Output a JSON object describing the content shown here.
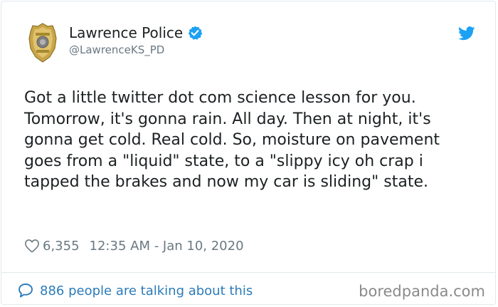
{
  "header": {
    "display_name": "Lawrence Police",
    "handle": "@LawrenceKS_PD",
    "avatar_icon": "police-badge-icon",
    "verified_icon": "verified-badge-icon",
    "platform_icon": "twitter-bird-icon"
  },
  "tweet": {
    "text": "Got a little twitter dot com science lesson for you. Tomorrow, it's gonna rain. All day. Then at night, it's gonna get cold. Real cold. So, moisture on pavement goes from a \"liquid\" state, to a \"slippy icy oh crap i tapped the brakes and now my car is sliding\" state."
  },
  "meta": {
    "like_icon": "heart-icon",
    "likes": "6,355",
    "timestamp": "12:35 AM - Jan 10, 2020"
  },
  "footer": {
    "conversation_icon": "speech-bubble-icon",
    "conversation_text": "886 people are talking about this"
  },
  "watermark": "boredpanda.com",
  "colors": {
    "link": "#2b7bb9",
    "verified": "#1da1f2",
    "secondary_text": "#697882",
    "primary_text": "#1c2022",
    "border": "#e1e8ed"
  }
}
